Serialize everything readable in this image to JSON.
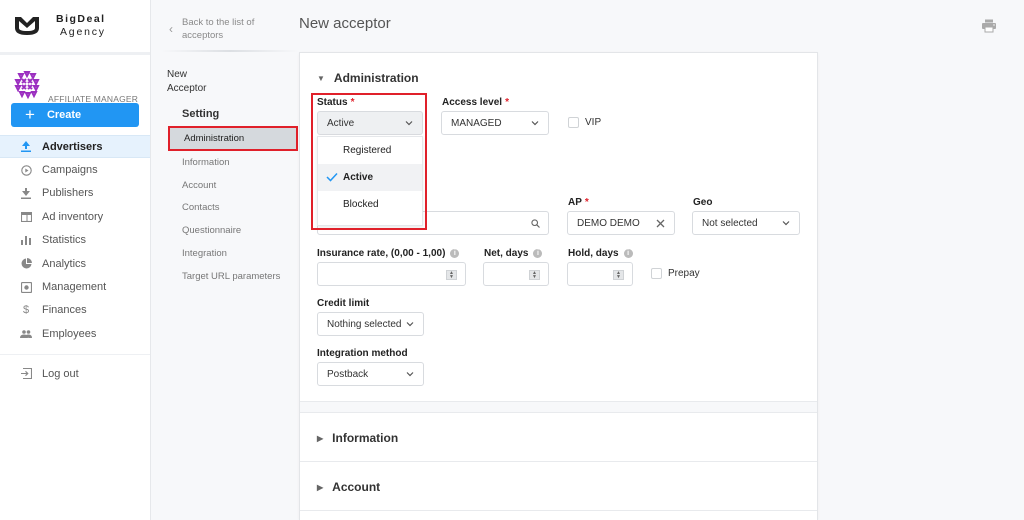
{
  "brand": {
    "line1": "BigDeal",
    "line2": "Agency"
  },
  "role": {
    "label": "AFFILIATE MANAGER"
  },
  "create_button": {
    "label": "Create"
  },
  "sidebar": {
    "items": [
      {
        "label": "Advertisers",
        "icon": "upload-icon",
        "active": true
      },
      {
        "label": "Campaigns",
        "icon": "play-circle-icon"
      },
      {
        "label": "Publishers",
        "icon": "download-icon"
      },
      {
        "label": "Ad inventory",
        "icon": "window-icon"
      },
      {
        "label": "Statistics",
        "icon": "bar-chart-icon"
      },
      {
        "label": "Analytics",
        "icon": "pie-chart-icon"
      },
      {
        "label": "Management",
        "icon": "management-icon"
      },
      {
        "label": "Finances",
        "icon": "dollar-icon"
      },
      {
        "label": "Employees",
        "icon": "people-icon"
      }
    ],
    "logout": {
      "label": "Log out",
      "icon": "logout-icon"
    }
  },
  "subnav": {
    "back_label": "Back to the list of acceptors",
    "entity_line1": "New",
    "entity_line2": "Acceptor",
    "group_label": "Setting",
    "items": [
      {
        "label": "Administration",
        "active": true
      },
      {
        "label": "Information"
      },
      {
        "label": "Account"
      },
      {
        "label": "Contacts"
      },
      {
        "label": "Questionnaire"
      },
      {
        "label": "Integration"
      },
      {
        "label": "Target URL parameters"
      }
    ]
  },
  "page": {
    "title": "New acceptor",
    "print_icon": "print-icon"
  },
  "sections": {
    "administration": {
      "title": "Administration",
      "status": {
        "label": "Status",
        "required_mark": "*",
        "value": "Active",
        "options": [
          {
            "label": "Registered",
            "selected": false
          },
          {
            "label": "Active",
            "selected": true
          },
          {
            "label": "Blocked",
            "selected": false
          }
        ]
      },
      "access_level": {
        "label": "Access level",
        "required_mark": "*",
        "value": "MANAGED"
      },
      "vip": {
        "label": "VIP",
        "checked": false
      },
      "search_field": {
        "value": ""
      },
      "ap": {
        "label": "AP",
        "required_mark": "*",
        "value": "DEMO DEMO"
      },
      "geo": {
        "label": "Geo",
        "value": "Not selected"
      },
      "insurance_rate": {
        "label": "Insurance rate, (0,00 - 1,00)",
        "value": ""
      },
      "net_days": {
        "label": "Net, days",
        "value": ""
      },
      "hold_days": {
        "label": "Hold, days",
        "value": ""
      },
      "prepay": {
        "label": "Prepay",
        "checked": false
      },
      "credit_limit": {
        "label": "Credit limit",
        "value": "Nothing selected"
      },
      "integration_method": {
        "label": "Integration method",
        "value": "Postback"
      }
    },
    "information": {
      "title": "Information"
    },
    "account": {
      "title": "Account"
    }
  }
}
